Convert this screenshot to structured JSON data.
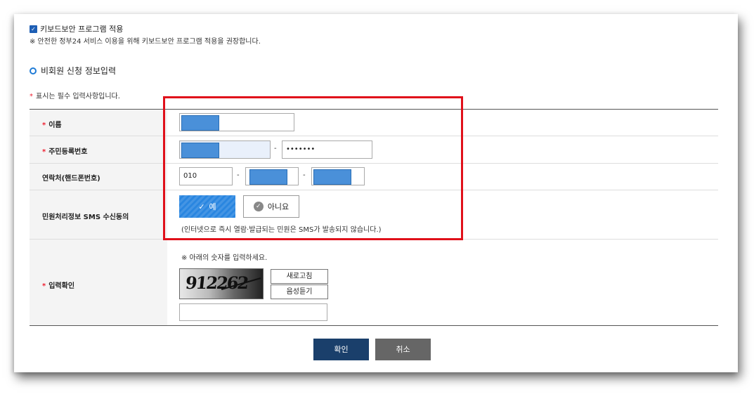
{
  "keyboard_security": {
    "checkbox_label": "키보드보안 프로그램 적용",
    "note": "※ 안전한 정부24 서비스 이용을 위해 키보드보안 프로그램 적용을 권장합니다."
  },
  "section_title": "비회원 신청 정보입력",
  "required_note": "표시는 필수 입력사항입니다.",
  "required_mark": "*",
  "form": {
    "name_label": "이름",
    "rrn_label": "주민등록번호",
    "rrn_back_value": "•••••••",
    "contact_label": "연락처(핸드폰번호)",
    "contact_prefix": "010",
    "sms_label": "민원처리정보 SMS 수신동의",
    "sms_yes": "예",
    "sms_no": "아니요",
    "sms_note": "(인터넷으로 즉시 열람·발급되는 민원은 SMS가 발송되지 않습니다.)",
    "captcha_label": "입력확인",
    "captcha_note": "※ 아래의 숫자를 입력하세요.",
    "captcha_value": "912262",
    "refresh_label": "새로고침",
    "audio_label": "음성듣기",
    "dash": "-"
  },
  "buttons": {
    "confirm": "확인",
    "cancel": "취소"
  },
  "colors": {
    "highlight_border": "#e0101a",
    "accent_blue": "#2a86e0",
    "confirm_bg": "#1a3f6b"
  },
  "icons": {
    "checkbox": "checkbox-checked-icon",
    "section": "ring-icon",
    "yes": "check-icon",
    "no": "check-circle-icon"
  }
}
